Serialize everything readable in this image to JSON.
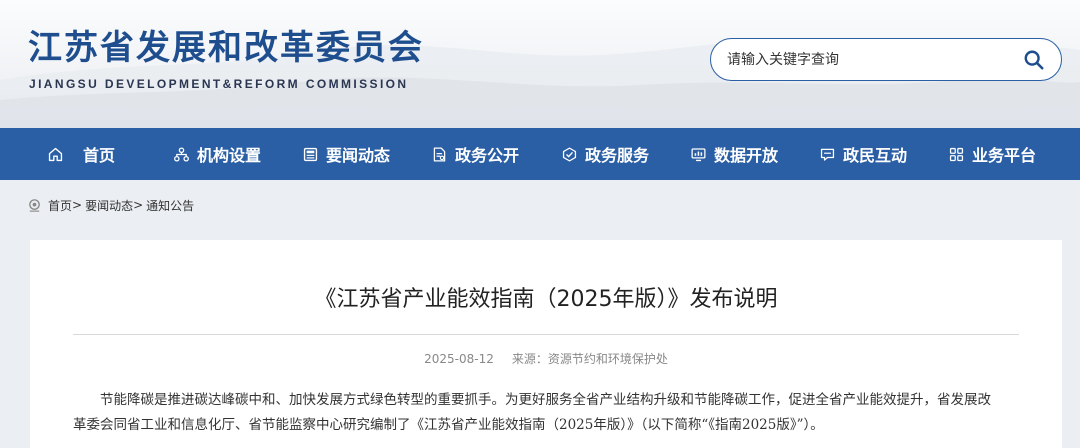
{
  "header": {
    "title": "江苏省发展和改革委员会",
    "subtitle": "JIANGSU DEVELOPMENT&REFORM COMMISSION",
    "search_placeholder": "请输入关键字查询"
  },
  "nav": {
    "items": [
      {
        "label": "首页",
        "icon": "home-icon"
      },
      {
        "label": "机构设置",
        "icon": "org-chart-icon"
      },
      {
        "label": "要闻动态",
        "icon": "news-icon"
      },
      {
        "label": "政务公开",
        "icon": "document-icon"
      },
      {
        "label": "政务服务",
        "icon": "service-icon"
      },
      {
        "label": "数据开放",
        "icon": "monitor-icon"
      },
      {
        "label": "政民互动",
        "icon": "chat-icon"
      },
      {
        "label": "业务平台",
        "icon": "grid-icon"
      }
    ]
  },
  "breadcrumb": {
    "items": [
      "首页",
      "要闻动态",
      "通知公告"
    ],
    "separator": ">"
  },
  "article": {
    "title": "《江苏省产业能效指南（2025年版）》发布说明",
    "date": "2025-08-12",
    "source": "来源：资源节约和环境保护处",
    "paragraph_line1": "节能降碳是推进碳达峰碳中和、加快发展方式绿色转型的重要抓手。为更好服务全省产业结构升级和节能降碳工作，促进全省产业能效提升，省发展改",
    "paragraph_line2": "革委会同省工业和信息化厅、省节能监察中心研究编制了《江苏省产业能效指南（2025年版）》（以下简称“《指南2025版》”）。"
  },
  "colors": {
    "primary": "#2a5fa5",
    "title": "#1f4e8f"
  }
}
